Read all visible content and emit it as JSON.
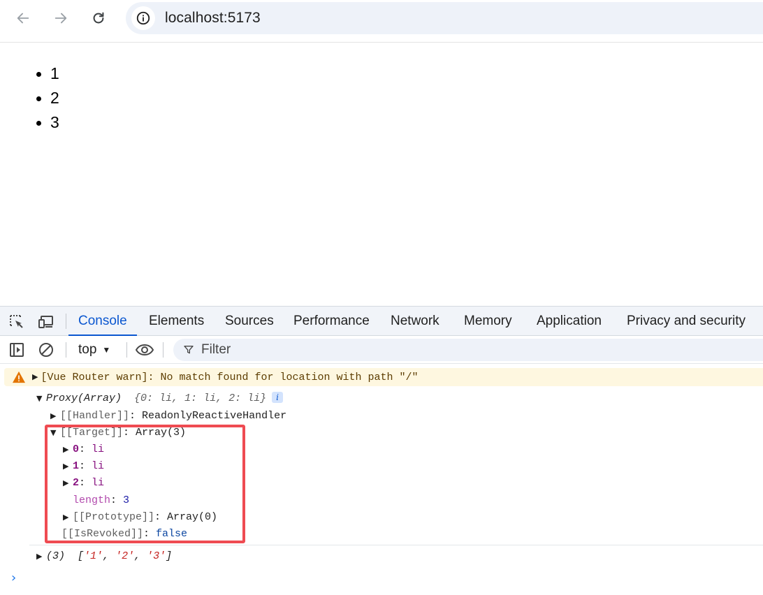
{
  "browser": {
    "url": "localhost:5173",
    "icons": {
      "back": "arrow-left-icon",
      "forward": "arrow-right-icon",
      "reload": "reload-icon",
      "site_info": "info-icon"
    }
  },
  "page": {
    "items": [
      "1",
      "2",
      "3"
    ]
  },
  "devtools": {
    "tabs": [
      {
        "label": "Console",
        "active": true
      },
      {
        "label": "Elements",
        "active": false
      },
      {
        "label": "Sources",
        "active": false
      },
      {
        "label": "Performance",
        "active": false
      },
      {
        "label": "Network",
        "active": false
      },
      {
        "label": "Memory",
        "active": false
      },
      {
        "label": "Application",
        "active": false
      },
      {
        "label": "Privacy and security",
        "active": false
      }
    ],
    "toolbar": {
      "context": "top",
      "filter_placeholder": "Filter"
    },
    "colors": {
      "accent": "#0b57d0",
      "warning_bg": "#fef7e0",
      "highlight_border": "#ef4b52"
    },
    "console": {
      "warning": "[Vue Router warn]: No match found for location with path \"/\"",
      "proxy_label": "Proxy(Array)",
      "proxy_preview": "{0: li, 1: li, 2: li}",
      "info_badge": "i",
      "handler_key": "[[Handler]]",
      "handler_value": "ReadonlyReactiveHandler",
      "target_key": "[[Target]]",
      "target_value": "Array(3)",
      "entries": [
        {
          "key": "0",
          "value": "li"
        },
        {
          "key": "1",
          "value": "li"
        },
        {
          "key": "2",
          "value": "li"
        }
      ],
      "length_key": "length",
      "length_value": "3",
      "prototype_key": "[[Prototype]]",
      "prototype_value": "Array(0)",
      "revoked_key": "[[IsRevoked]]",
      "revoked_value": "false",
      "array_count": "(3)",
      "array_values": [
        "'1'",
        "'2'",
        "'3'"
      ]
    }
  }
}
